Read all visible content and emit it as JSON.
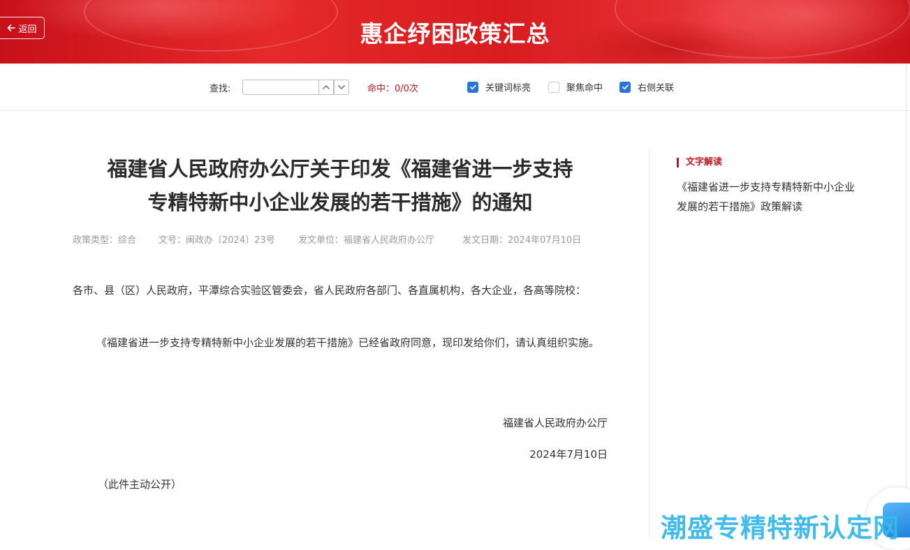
{
  "header": {
    "back_label": "返回",
    "title": "惠企纾困政策汇总"
  },
  "toolbar": {
    "search_label": "查找:",
    "search_value": "",
    "hits_text": "命中：0/0次",
    "options": [
      {
        "label": "关键词标亮",
        "checked": true
      },
      {
        "label": "聚焦命中",
        "checked": false
      },
      {
        "label": "右侧关联",
        "checked": true
      }
    ]
  },
  "article": {
    "title_line1": "福建省人民政府办公厅关于印发《福建省进一步支持",
    "title_line2": "专精特新中小企业发展的若干措施》的通知",
    "meta": {
      "type": "政策类型：综合",
      "doc_no": "文号：闽政办〔2024〕23号",
      "issuer": "发文单位：福建省人民政府办公厅",
      "date": "发文日期：2024年07月10日"
    },
    "salutation": "各市、县（区）人民政府，平潭综合实验区管委会，省人民政府各部门、各直属机构，各大企业，各高等院校：",
    "body": "《福建省进一步支持专精特新中小企业发展的若干措施》已经省政府同意，现印发给你们，请认真组织实施。",
    "signature": "福建省人民政府办公厅",
    "sign_date": "2024年7月10日",
    "note": "（此件主动公开）"
  },
  "sidebar": {
    "heading": "文字解读",
    "link": "《福建省进一步支持专精特新中小企业发展的若干措施》政策解读"
  },
  "watermark": "潮盛专精特新认定网",
  "colors": {
    "brand_red": "#c0161d",
    "checkbox_blue": "#2a74d9",
    "watermark_blue": "#37b8e8"
  }
}
